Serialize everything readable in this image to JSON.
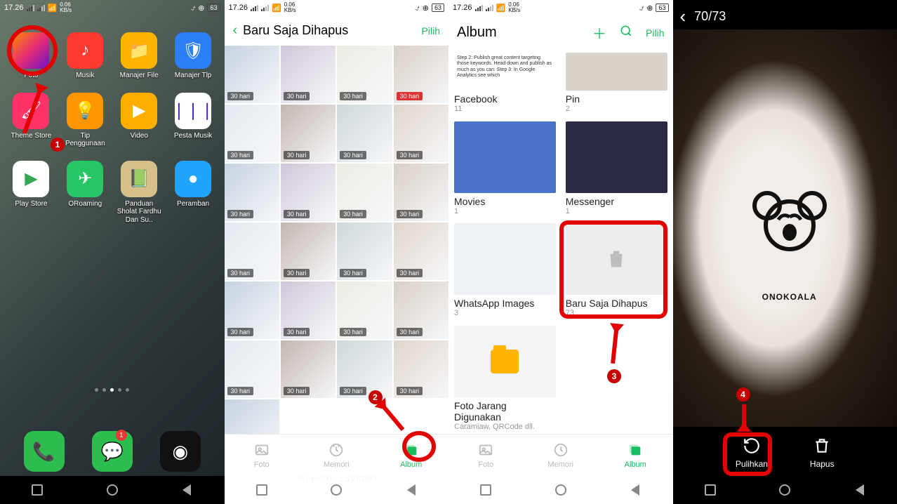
{
  "status": {
    "time": "17.26",
    "net": "0.06",
    "netUnit": "KB/s",
    "batt": "63"
  },
  "home": {
    "apps": [
      {
        "label": "Foto",
        "bg": "linear-gradient(135deg,#ff8a00,#e52e71,#6a11cb)",
        "glyph": ""
      },
      {
        "label": "Musik",
        "bg": "#ff3b30",
        "glyph": "♪"
      },
      {
        "label": "Manajer File",
        "bg": "#ffb400",
        "glyph": "📁"
      },
      {
        "label": "Manajer Tlp",
        "bg": "#2d7ff9",
        "glyph": "🛡"
      },
      {
        "label": "Theme Store",
        "bg": "#ff3368",
        "glyph": "🖌"
      },
      {
        "label": "Tip Penggunaan",
        "bg": "#ff9500",
        "glyph": "💡"
      },
      {
        "label": "Video",
        "bg": "#ffae00",
        "glyph": "▶"
      },
      {
        "label": "Pesta Musik",
        "bg": "#fff",
        "glyph": "❘❘❘",
        "fg": "#42c"
      },
      {
        "label": "Play Store",
        "bg": "#fff",
        "glyph": "▶",
        "fg": "#34a853"
      },
      {
        "label": "ORoaming",
        "bg": "#27c667",
        "glyph": "✈"
      },
      {
        "label": "Panduan Sholat Fardhu Dan Su..",
        "bg": "#d6c08a",
        "glyph": "📗"
      },
      {
        "label": "Peramban",
        "bg": "#1fa5ff",
        "glyph": "●"
      }
    ],
    "dock": [
      {
        "bg": "#2dbd4e",
        "glyph": "📞"
      },
      {
        "bg": "#2dbd4e",
        "glyph": "💬",
        "badge": "1"
      },
      {
        "bg": "#111",
        "glyph": "◉"
      }
    ],
    "step": "1"
  },
  "deleted": {
    "title": "Baru Saja Dihapus",
    "action": "Pilih",
    "tag": "30 hari",
    "summary": "60 Foto, 13Video",
    "tabs": {
      "foto": "Foto",
      "memori": "Memori",
      "album": "Album"
    },
    "step": "2"
  },
  "albums": {
    "title": "Album",
    "action": "Pilih",
    "items": [
      {
        "name": "Facebook",
        "count": "11",
        "thumb": "#fff",
        "note": "Step 2: Publish great content targeting those keywords. Head down and publish as much as you can.\nStep 3: In Google Analytics see which"
      },
      {
        "name": "Pin",
        "count": "2",
        "thumb": "#d9d2c8"
      },
      {
        "name": "Movies",
        "count": "1",
        "thumb": "#4a74c7"
      },
      {
        "name": "Messenger",
        "count": "1",
        "thumb": "#2a2a44"
      },
      {
        "name": "WhatsApp Images",
        "count": "3",
        "thumb": "#eef1f5"
      },
      {
        "name": "Baru Saja Dihapus",
        "count": "73",
        "thumb": "#e8e8e8",
        "trash": true
      },
      {
        "name": "Foto Jarang Digunakan",
        "sub": "Caramiaw, QRCode dll.",
        "thumb": "#ffb400",
        "folder": true
      }
    ],
    "tabs": {
      "foto": "Foto",
      "memori": "Memori",
      "album": "Album"
    },
    "step": "3"
  },
  "viewer": {
    "counter": "70/73",
    "brand": "ONOKOALA",
    "actions": {
      "restore": "Pulihkan",
      "delete": "Hapus"
    },
    "step": "4"
  }
}
